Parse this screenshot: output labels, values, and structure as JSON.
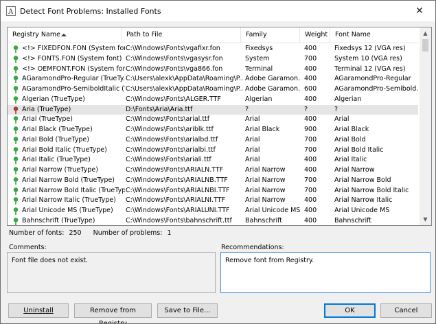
{
  "window": {
    "title": "Detect Font Problems: Installed Fonts",
    "close_glyph": "✕"
  },
  "columns": [
    "Registry Name",
    "Path to File",
    "Family",
    "Weight",
    "Font Name"
  ],
  "rows": [
    {
      "status": "ok",
      "name": "<!> FIXEDFON.FON (System font)",
      "path": "C:\\Windows\\Fonts\\vgafixr.fon",
      "family": "Fixedsys",
      "weight": "400",
      "font": "Fixedsys 12 (VGA res)"
    },
    {
      "status": "ok",
      "name": "<!> FONTS.FON (System font)",
      "path": "C:\\Windows\\Fonts\\vgasysr.fon",
      "family": "System",
      "weight": "700",
      "font": "System 10 (VGA res)"
    },
    {
      "status": "ok",
      "name": "<!> OEMFONT.FON (System font)",
      "path": "C:\\Windows\\Fonts\\vga866.fon",
      "family": "Terminal",
      "weight": "400",
      "font": "Terminal 12 (VGA res)"
    },
    {
      "status": "ok",
      "name": "AGaramondPro-Regular (TrueTy...",
      "path": "C:\\Users\\alexk\\AppData\\Roaming\\P...",
      "family": "Adobe Garamon...",
      "weight": "400",
      "font": "AGaramondPro-Regular"
    },
    {
      "status": "ok",
      "name": "AGaramondPro-SemiboldItalic (Tr...",
      "path": "C:\\Users\\alexk\\AppData\\Roaming\\P...",
      "family": "Adobe Garamon...",
      "weight": "600",
      "font": "AGaramondPro-Semibold..."
    },
    {
      "status": "ok",
      "name": "Algerian (TrueType)",
      "path": "C:\\Windows\\Fonts\\ALGER.TTF",
      "family": "Algerian",
      "weight": "400",
      "font": "Algerian"
    },
    {
      "status": "error",
      "name": "Aria (TrueType)",
      "path": "D:\\Fonts\\Aria\\Aria.ttf",
      "family": "?",
      "weight": "?",
      "font": "?"
    },
    {
      "status": "ok",
      "name": "Arial (TrueType)",
      "path": "C:\\Windows\\Fonts\\arial.ttf",
      "family": "Arial",
      "weight": "400",
      "font": "Arial"
    },
    {
      "status": "ok",
      "name": "Arial Black (TrueType)",
      "path": "C:\\Windows\\Fonts\\ariblk.ttf",
      "family": "Arial Black",
      "weight": "900",
      "font": "Arial Black"
    },
    {
      "status": "ok",
      "name": "Arial Bold (TrueType)",
      "path": "C:\\Windows\\Fonts\\arialbd.ttf",
      "family": "Arial",
      "weight": "700",
      "font": "Arial Bold"
    },
    {
      "status": "ok",
      "name": "Arial Bold Italic (TrueType)",
      "path": "C:\\Windows\\Fonts\\arialbi.ttf",
      "family": "Arial",
      "weight": "700",
      "font": "Arial Bold Italic"
    },
    {
      "status": "ok",
      "name": "Arial Italic (TrueType)",
      "path": "C:\\Windows\\Fonts\\ariali.ttf",
      "family": "Arial",
      "weight": "400",
      "font": "Arial Italic"
    },
    {
      "status": "ok",
      "name": "Arial Narrow (TrueType)",
      "path": "C:\\Windows\\Fonts\\ARIALN.TTF",
      "family": "Arial Narrow",
      "weight": "400",
      "font": "Arial Narrow"
    },
    {
      "status": "ok",
      "name": "Arial Narrow Bold (TrueType)",
      "path": "C:\\Windows\\Fonts\\ARIALNB.TTF",
      "family": "Arial Narrow",
      "weight": "700",
      "font": "Arial Narrow Bold"
    },
    {
      "status": "ok",
      "name": "Arial Narrow Bold Italic (TrueType)",
      "path": "C:\\Windows\\Fonts\\ARIALNBI.TTF",
      "family": "Arial Narrow",
      "weight": "700",
      "font": "Arial Narrow Bold Italic"
    },
    {
      "status": "ok",
      "name": "Arial Narrow Italic (TrueType)",
      "path": "C:\\Windows\\Fonts\\ARIALNI.TTF",
      "family": "Arial Narrow",
      "weight": "400",
      "font": "Arial Narrow Italic"
    },
    {
      "status": "ok",
      "name": "Arial Unicode MS (TrueType)",
      "path": "C:\\Windows\\Fonts\\ARIALUNI.TTF",
      "family": "Arial Unicode MS",
      "weight": "400",
      "font": "Arial Unicode MS"
    },
    {
      "status": "ok",
      "name": "Bahnschrift (TrueType)",
      "path": "C:\\Windows\\Fonts\\bahnschrift.ttf",
      "family": "Bahnschrift",
      "weight": "400",
      "font": "Bahnschrift"
    }
  ],
  "stats": {
    "fonts_label": "Number of fonts:",
    "fonts_value": "250",
    "problems_label": "Number of problems:",
    "problems_value": "1"
  },
  "comments": {
    "label": "Comments:",
    "text": "Font file does not exist."
  },
  "recommendations": {
    "label": "Recommendations:",
    "text": "Remove font from Registry."
  },
  "buttons": {
    "uninstall": "Uninstall",
    "remove": "Remove from Registry",
    "save": "Save to File...",
    "ok": "OK",
    "cancel": "Cancel"
  },
  "colors": {
    "ok_icon": "#3aa845",
    "error_icon": "#b23a3a",
    "default_border": "#0078d7"
  }
}
